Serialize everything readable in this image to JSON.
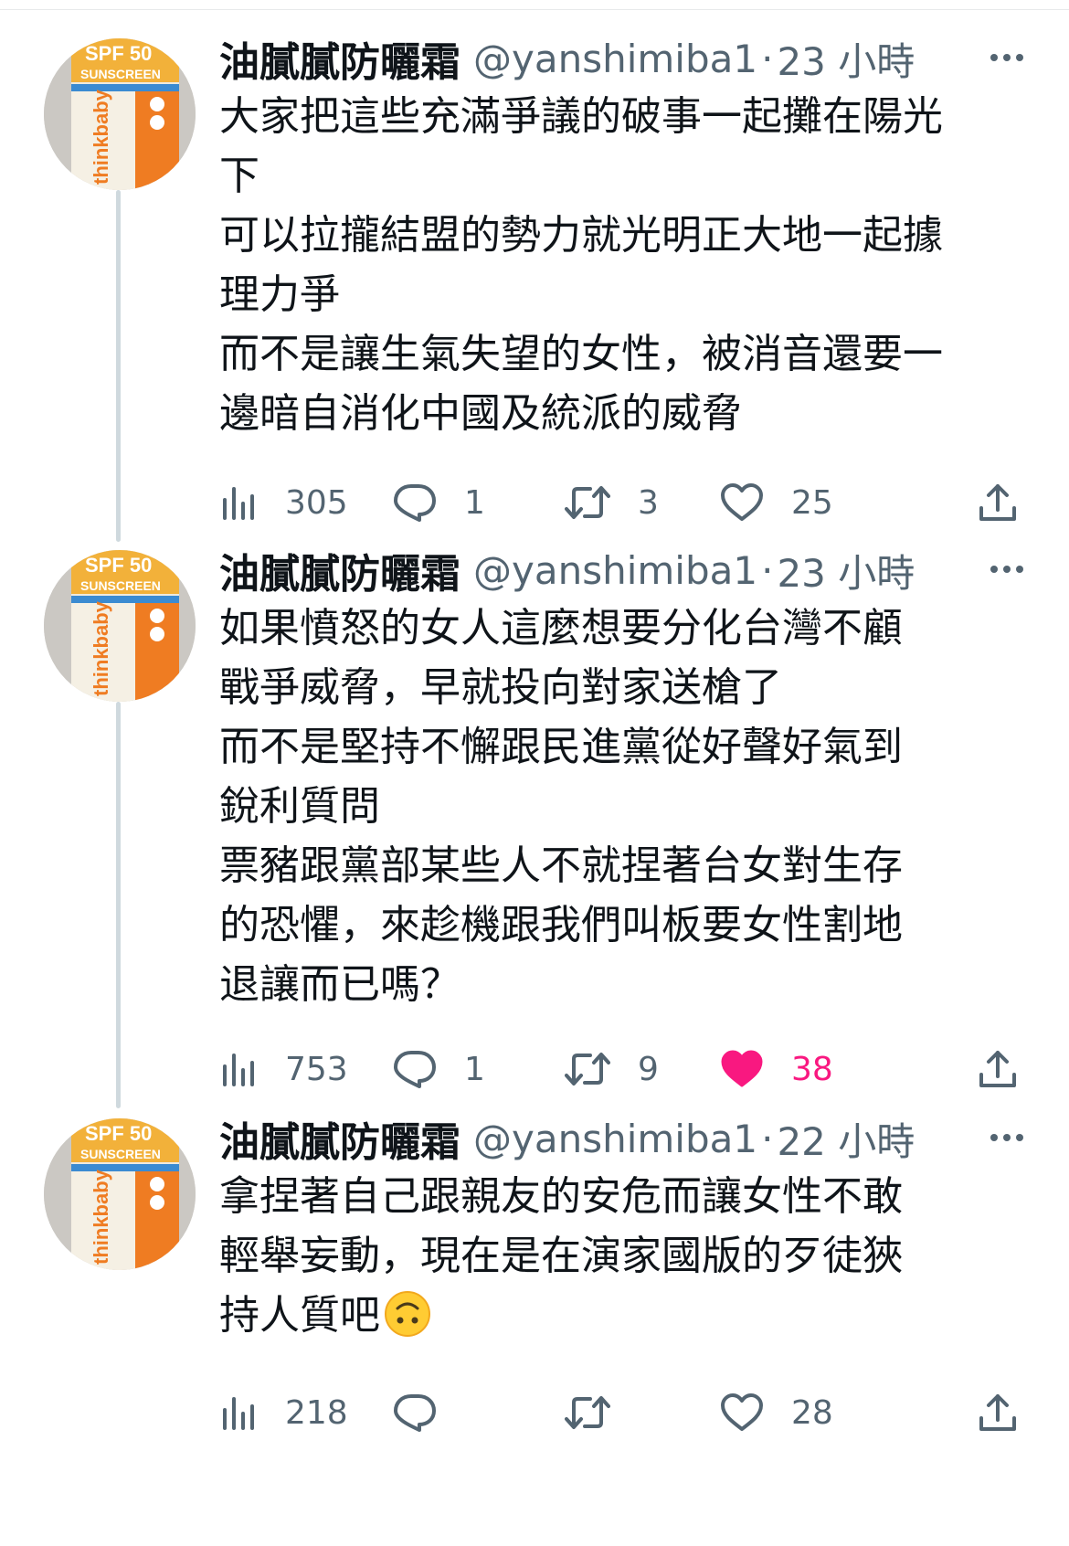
{
  "colors": {
    "text": "#0f1419",
    "secondary": "#536471",
    "like_active": "#f91880",
    "thread_line": "#cfd9de"
  },
  "avatar_label": {
    "spf": "SPF 50",
    "sunscreen": "SUNSCREEN",
    "brand": "thinkbaby"
  },
  "tweets": [
    {
      "author": "油膩膩防曬霜",
      "handle": "@yanshimiba1",
      "separator": "·",
      "time": "23 小時",
      "lines": [
        "大家把這些充滿爭議的破事一起攤在陽光",
        "下",
        "可以拉攏結盟的勢力就光明正大地一起據",
        "理力爭",
        "而不是讓生氣失望的女性，被消音還要一",
        "邊暗自消化中國及統派的威脅"
      ],
      "stats": {
        "views": "305",
        "replies": "1",
        "retweets": "3",
        "likes": "25",
        "liked": false
      }
    },
    {
      "author": "油膩膩防曬霜",
      "handle": "@yanshimiba1",
      "separator": "·",
      "time": "23 小時",
      "lines": [
        "如果憤怒的女人這麼想要分化台灣不顧",
        "戰爭威脅，早就投向對家送槍了",
        "而不是堅持不懈跟民進黨從好聲好氣到",
        "銳利質問",
        "票豬跟黨部某些人不就捏著台女對生存",
        "的恐懼，來趁機跟我們叫板要女性割地",
        "退讓而已嗎？"
      ],
      "stats": {
        "views": "753",
        "replies": "1",
        "retweets": "9",
        "likes": "38",
        "liked": true
      }
    },
    {
      "author": "油膩膩防曬霜",
      "handle": "@yanshimiba1",
      "separator": "·",
      "time": "22 小時",
      "lines": [
        "拿捏著自己跟親友的安危而讓女性不敢",
        "輕舉妄動，現在是在演家國版的歹徒狹",
        "持人質吧"
      ],
      "emoji": "upside-down-face-emoji",
      "stats": {
        "views": "218",
        "replies": "",
        "retweets": "",
        "likes": "28",
        "liked": false
      }
    }
  ]
}
